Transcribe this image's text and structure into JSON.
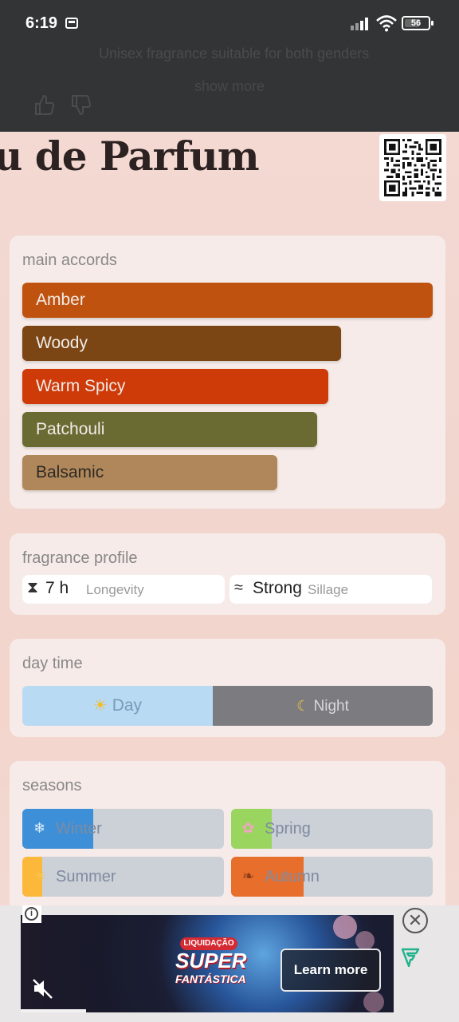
{
  "status_bar": {
    "time": "6:19",
    "battery": "56"
  },
  "header": {
    "unisex_text": "Unisex fragrance suitable for both genders",
    "show_more": "show more",
    "title": "u de Parfum"
  },
  "main_accords": {
    "label": "main accords",
    "items": [
      {
        "label": "Amber",
        "color": "#c0520f",
        "strength": 1.0
      },
      {
        "label": "Woody",
        "color": "#7b4614",
        "strength": 0.776
      },
      {
        "label": "Warm Spicy",
        "color": "#cf3a09",
        "strength": 0.745
      },
      {
        "label": "Patchouli",
        "color": "#6a6b33",
        "strength": 0.718
      },
      {
        "label": "Balsamic",
        "color": "#b0875a",
        "strength": 0.621
      }
    ]
  },
  "fragrance_profile": {
    "label": "fragrance profile",
    "longevity_value": "7 h",
    "longevity_label": "Longevity",
    "sillage_value": "Strong",
    "sillage_label": "Sillage"
  },
  "day_time": {
    "label": "day time",
    "day_label": "Day",
    "night_label": "Night",
    "day_share": 0.464
  },
  "seasons": {
    "label": "seasons",
    "items": [
      {
        "label": "Winter",
        "color": "#3d8fd8",
        "fill": 0.35
      },
      {
        "label": "Spring",
        "color": "#9ad560",
        "fill": 0.2
      },
      {
        "label": "Summer",
        "color": "#fbb83a",
        "fill": 0.1
      },
      {
        "label": "Autumn",
        "color": "#e86e2c",
        "fill": 0.36
      }
    ]
  },
  "ad": {
    "learn_more": "Learn more",
    "brand_top": "LIQUIDAÇÃO",
    "brand_main": "SUPER",
    "brand_sub": "FANTÁSTICA"
  }
}
